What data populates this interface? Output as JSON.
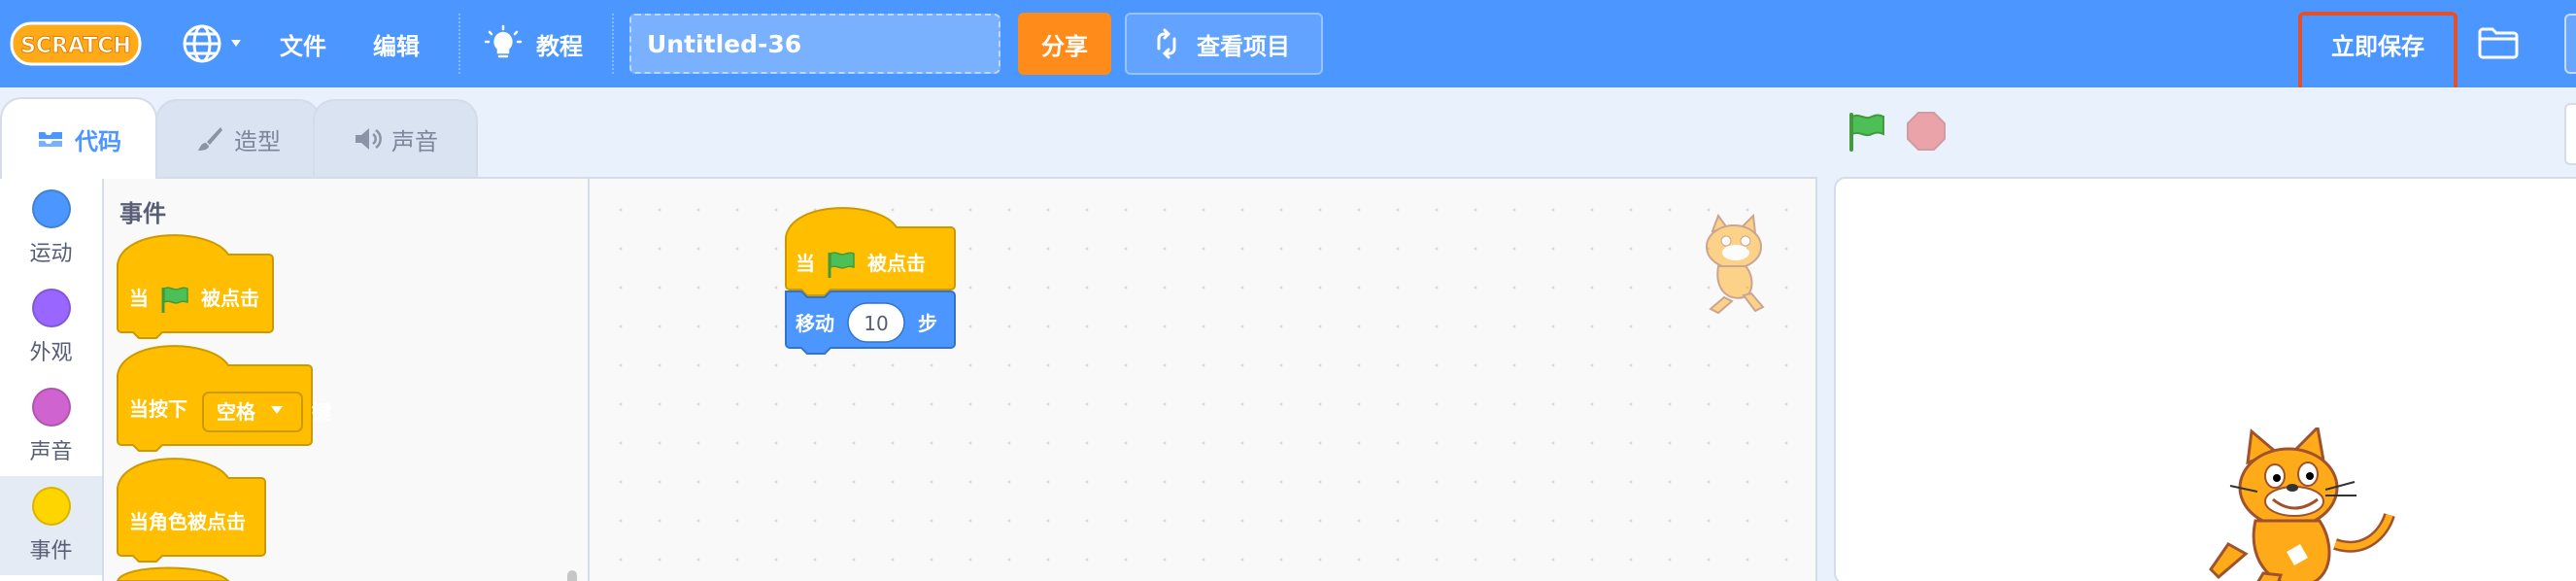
{
  "menubar": {
    "logo_text": "SCRATCH",
    "file_label": "文件",
    "edit_label": "编辑",
    "tutorials_label": "教程",
    "project_title": "Untitled-36",
    "share_label": "分享",
    "see_project_label": "查看项目",
    "save_now_label": "立即保存"
  },
  "tabs": {
    "code_label": "代码",
    "costumes_label": "造型",
    "sounds_label": "声音"
  },
  "categories": [
    {
      "label": "运动",
      "color": "#4c97ff"
    },
    {
      "label": "外观",
      "color": "#9966ff"
    },
    {
      "label": "声音",
      "color": "#cf63cf"
    },
    {
      "label": "事件",
      "color": "#ffd500"
    }
  ],
  "flyout": {
    "section_label": "事件",
    "when_flag_clicked_prefix": "当",
    "when_flag_clicked_suffix": "被点击",
    "when_key_pressed_prefix": "当按下",
    "key_option": "空格",
    "when_key_pressed_suffix": "键",
    "when_sprite_clicked": "当角色被点击"
  },
  "script": {
    "hat_prefix": "当",
    "hat_suffix": "被点击",
    "move_label": "移动",
    "move_steps": "10",
    "steps_unit": "步"
  },
  "colors": {
    "menubar": "#4c97ff",
    "events": "#ffbf00",
    "events_border": "#cc9900",
    "motion": "#4c97ff",
    "motion_border": "#3373cc",
    "save_highlight": "#e4502a",
    "share": "#ff8c1a"
  },
  "icons": [
    "scratch-logo",
    "globe-icon",
    "lightbulb-icon",
    "remix-arrows-icon",
    "folder-icon",
    "code-tab-icon",
    "brush-icon",
    "speaker-icon",
    "green-flag-icon",
    "stop-icon",
    "sprite-cat"
  ]
}
